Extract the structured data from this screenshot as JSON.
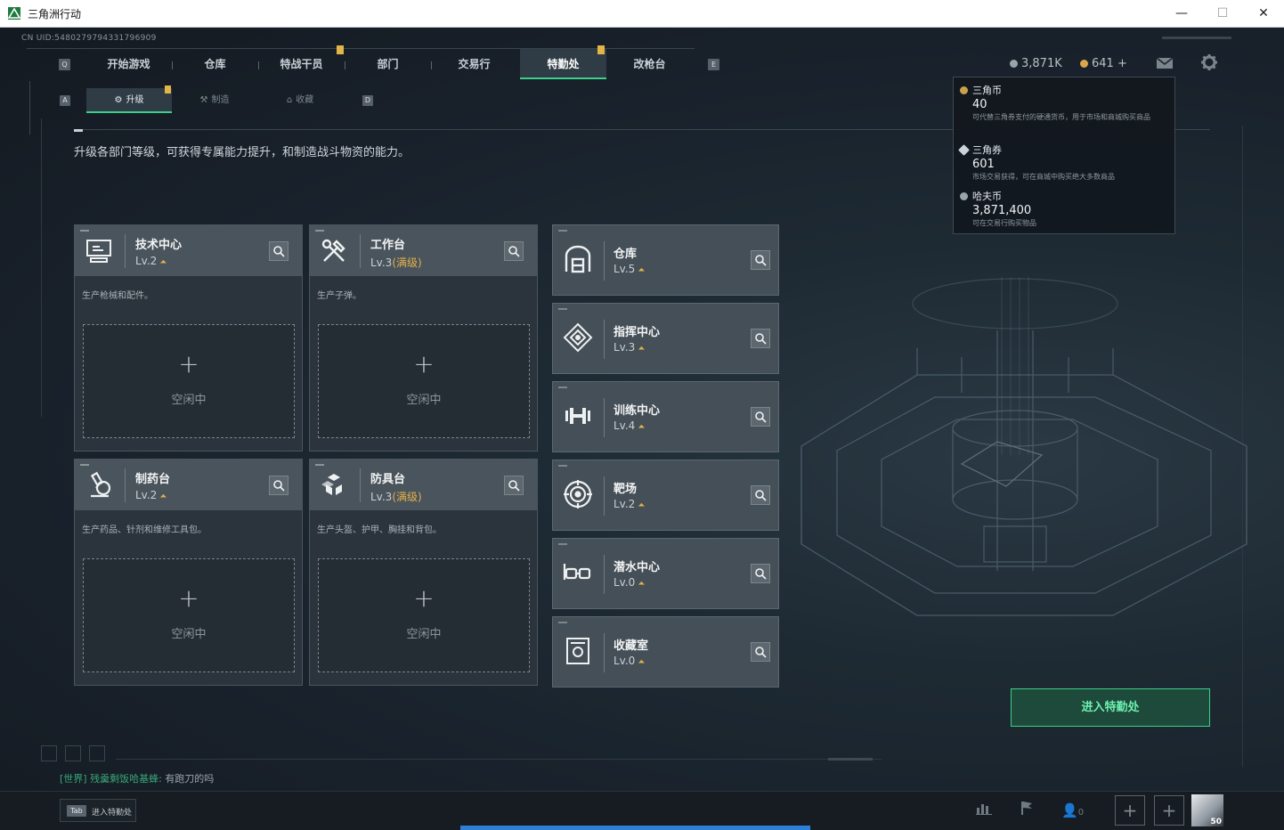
{
  "window": {
    "title": "三角洲行动",
    "minimize": "—",
    "maximize": "☐",
    "close": "✕"
  },
  "uid": "CN UID:5480279794331796909",
  "nav": {
    "left_key": "Q",
    "right_key": "E",
    "tabs": [
      {
        "label": "开始游戏"
      },
      {
        "label": "仓库"
      },
      {
        "label": "特战干员"
      },
      {
        "label": "部门"
      },
      {
        "label": "交易行"
      },
      {
        "label": "特勤处",
        "active": true
      },
      {
        "label": "改枪台"
      }
    ]
  },
  "subnav": {
    "left_key": "A",
    "right_key": "D",
    "tabs": [
      {
        "label": "升级",
        "active": true
      },
      {
        "label": "制造"
      },
      {
        "label": "收藏"
      }
    ]
  },
  "description": "升级各部门等级，可获得专属能力提升，和制造战斗物资的能力。",
  "currency": {
    "hafu_short": "3,871K",
    "ticket": "641",
    "plus": "+"
  },
  "tooltip": {
    "items": [
      {
        "name": "三角币",
        "value": "40",
        "desc": "可代替三角券支付的硬通货币，用于市场和商城购买商品"
      },
      {
        "name": "三角券",
        "value": "601",
        "desc": "市场交易获得，可在商城中购买绝大多数商品"
      },
      {
        "name": "哈夫币",
        "value": "3,871,400",
        "desc": "可在交易行购买物品"
      }
    ]
  },
  "production": [
    {
      "name": "技术中心",
      "level": "Lv.2",
      "max": "",
      "desc": "生产枪械和配件。",
      "idle": "空闲中",
      "plus": "+",
      "icon": "computer-icon"
    },
    {
      "name": "工作台",
      "level": "Lv.3",
      "max": "(满级)",
      "desc": "生产子弹。",
      "idle": "空闲中",
      "plus": "+",
      "icon": "tools-icon"
    },
    {
      "name": "制药台",
      "level": "Lv.2",
      "max": "",
      "desc": "生产药品、针剂和维修工具包。",
      "idle": "空闲中",
      "plus": "+",
      "icon": "microscope-icon"
    },
    {
      "name": "防具台",
      "level": "Lv.3",
      "max": "(满级)",
      "desc": "生产头盔、护甲、胸挂和背包。",
      "idle": "空闲中",
      "plus": "+",
      "icon": "armor-icon"
    }
  ],
  "facilities": [
    {
      "name": "仓库",
      "level": "Lv.5",
      "icon": "warehouse-icon"
    },
    {
      "name": "指挥中心",
      "level": "Lv.3",
      "icon": "command-icon"
    },
    {
      "name": "训练中心",
      "level": "Lv.4",
      "icon": "dumbbell-icon"
    },
    {
      "name": "靶场",
      "level": "Lv.2",
      "icon": "target-icon"
    },
    {
      "name": "潜水中心",
      "level": "Lv.0",
      "icon": "goggles-icon"
    },
    {
      "name": "收藏室",
      "level": "Lv.0",
      "icon": "collection-icon"
    }
  ],
  "enter_button": "进入特勤处",
  "chat": {
    "channel": "[世界]",
    "sender": "残羹剩饭哈基蜂:",
    "message": "有跑刀的吗"
  },
  "bottom": {
    "tab_key": "Tab",
    "tab_label": "进入特勤处",
    "friends": "0",
    "avatar_level": "50"
  },
  "colors": {
    "accent": "#3bd08b",
    "gold": "#e3b04b",
    "progress": "#2e7fd8"
  }
}
